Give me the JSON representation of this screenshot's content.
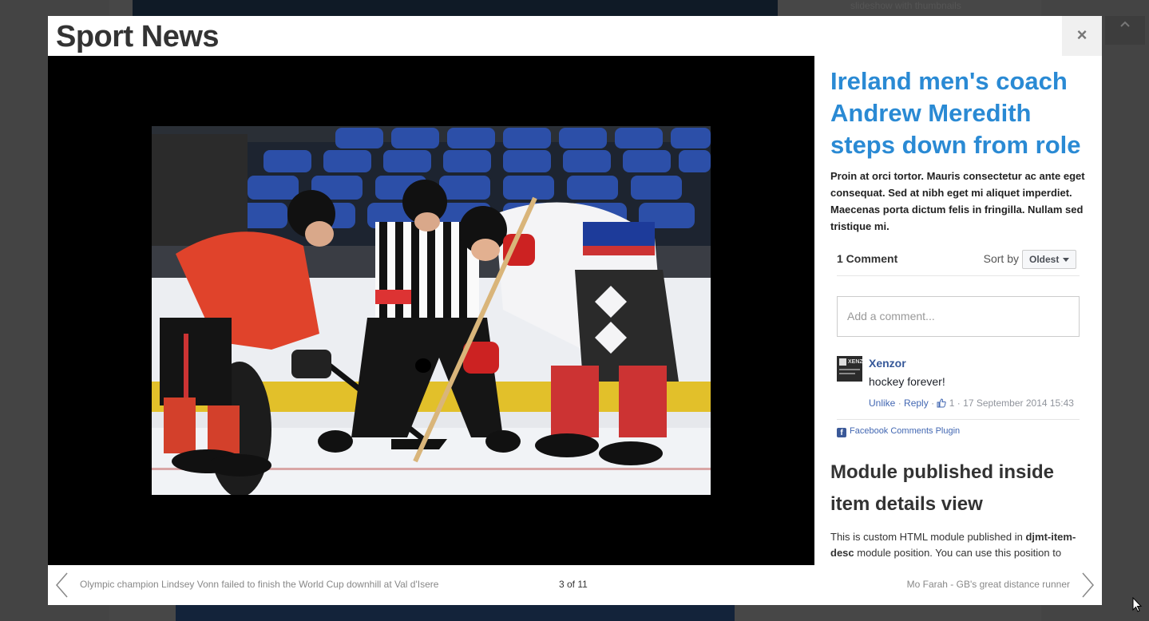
{
  "background": {
    "sidebar_text": "slideshow with thumbnails",
    "scroll_top_icon": "chevron-up-icon"
  },
  "modal": {
    "title": "Sport News",
    "close_icon": "×"
  },
  "article": {
    "title": "Ireland men's coach Andrew Meredith steps down from role",
    "intro": "Proin at orci tortor. Mauris consectetur ac ante eget consequat. Sed at nibh eget mi aliquet imperdiet. Maecenas porta dictum felis in fringilla. Nullam sed tristique mi."
  },
  "comments": {
    "count_label": "1 Comment",
    "sort_label": "Sort by",
    "sort_value": "Oldest",
    "input_placeholder": "Add a comment...",
    "items": [
      {
        "author": "Xenzor",
        "avatar_text": "XENZ",
        "text": "hockey forever!",
        "unlike": "Unlike",
        "reply": "Reply",
        "likes": "1",
        "timestamp": "17 September 2014 15:43"
      }
    ],
    "plugin_label": "Facebook Comments Plugin"
  },
  "module": {
    "title": "Module published inside item details view",
    "text_before": "This is custom HTML module published in ",
    "position_name": "djmt-item-desc",
    "text_after": " module position. You can use this position to"
  },
  "footer": {
    "prev_title": "Olympic champion Lindsey Vonn failed to finish the World Cup downhill at Val d'Isere",
    "counter": "3 of 11",
    "next_title": "Mo Farah - GB's great distance runner"
  },
  "colors": {
    "accent": "#2a8ad4",
    "facebook_link": "#4267b2",
    "facebook_author": "#365899"
  }
}
